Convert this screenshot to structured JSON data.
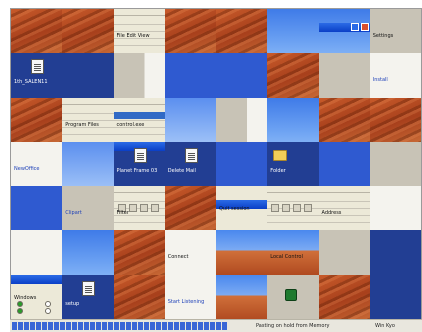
{
  "board": {
    "columns": 8,
    "rows": 7,
    "tiles": [
      {
        "style": "desert"
      },
      {
        "style": "desert"
      },
      {
        "style": "window",
        "label": "File Edit View",
        "label_tone": "black"
      },
      {
        "style": "desert"
      },
      {
        "style": "desert"
      },
      {
        "style": "sky"
      },
      {
        "style": "sky",
        "window": true
      },
      {
        "style": "grey",
        "label": "Settings",
        "label_tone": "black"
      },
      {
        "style": "navy",
        "icon": "file",
        "label": "1th_SALEN11",
        "label_tone": "white"
      },
      {
        "style": "navy"
      },
      {
        "style": "split-grey"
      },
      {
        "style": "blue"
      },
      {
        "style": "blue"
      },
      {
        "style": "desert"
      },
      {
        "style": "grey"
      },
      {
        "style": "white",
        "label": "Install",
        "label_tone": "blue"
      },
      {
        "style": "desert"
      },
      {
        "style": "window",
        "label": "Program Files",
        "label_tone": "black"
      },
      {
        "style": "window",
        "label": "control.exe",
        "label_tone": "black",
        "highlight": true
      },
      {
        "style": "skylight"
      },
      {
        "style": "split-grey"
      },
      {
        "style": "sky"
      },
      {
        "style": "desert"
      },
      {
        "style": "desert"
      },
      {
        "style": "white",
        "label": "NewOffice",
        "label_tone": "blue"
      },
      {
        "style": "skylight"
      },
      {
        "style": "navy",
        "icon": "file",
        "label": "Planet Frame 03",
        "label_tone": "white",
        "titlebar": "top"
      },
      {
        "style": "navy",
        "icon": "file",
        "label": "Delete Mail",
        "label_tone": "white"
      },
      {
        "style": "blue"
      },
      {
        "style": "navy",
        "icon": "folder",
        "label": "Folder",
        "label_tone": "white"
      },
      {
        "style": "blue"
      },
      {
        "style": "grey"
      },
      {
        "style": "blue"
      },
      {
        "style": "grey",
        "label": "Clipart",
        "label_tone": "blue"
      },
      {
        "style": "window",
        "label": "Filter",
        "label_tone": "black",
        "toolbar": true
      },
      {
        "style": "desert"
      },
      {
        "style": "window",
        "label": "Quit session",
        "label_tone": "black",
        "titlebar": "mid"
      },
      {
        "style": "window",
        "toolbar": true
      },
      {
        "style": "window",
        "label": "Address",
        "label_tone": "black"
      },
      {
        "style": "white"
      },
      {
        "style": "white"
      },
      {
        "style": "sky"
      },
      {
        "style": "desert"
      },
      {
        "style": "white",
        "label": "Connect",
        "label_tone": "black"
      },
      {
        "style": "dune"
      },
      {
        "style": "dune",
        "label": "Local Control",
        "label_tone": "black"
      },
      {
        "style": "grey"
      },
      {
        "style": "navy"
      },
      {
        "style": "window",
        "label": "Windows",
        "label_tone": "black",
        "titlebar": "top"
      },
      {
        "style": "navy",
        "icon": "file",
        "label": "setup",
        "label_tone": "white"
      },
      {
        "style": "desert"
      },
      {
        "style": "white",
        "label": "Start Listening",
        "label_tone": "blue"
      },
      {
        "style": "dune"
      },
      {
        "style": "grey"
      },
      {
        "style": "desert"
      },
      {
        "style": "navy"
      }
    ]
  },
  "status": {
    "message": "Pasting on hold from Memory",
    "right": "Win Kyo"
  }
}
